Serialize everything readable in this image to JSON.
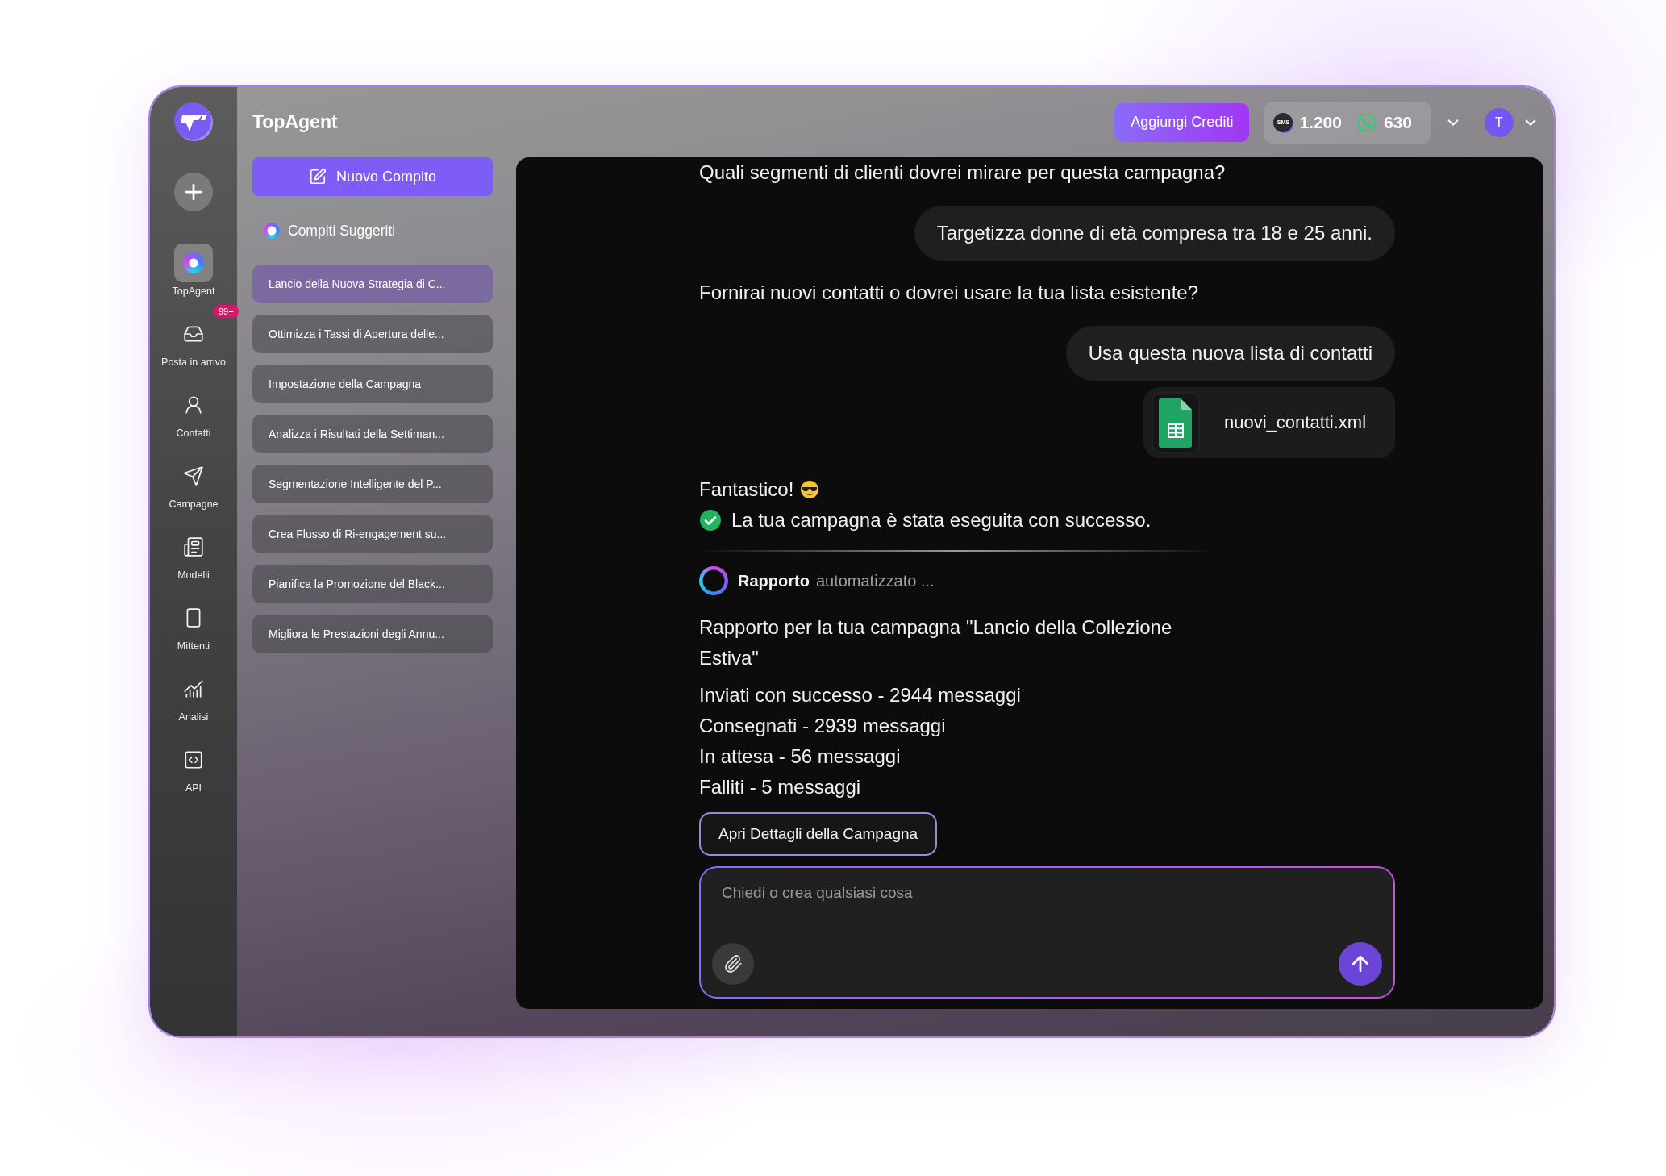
{
  "app": {
    "name": "TopAgent"
  },
  "rail": {
    "items": [
      {
        "label": "TopAgent",
        "selected": true
      },
      {
        "label": "Posta in arrivo",
        "selected": false,
        "badge": "99+"
      },
      {
        "label": "Contatti",
        "selected": false
      },
      {
        "label": "Campagne",
        "selected": false
      },
      {
        "label": "Modelli",
        "selected": false
      },
      {
        "label": "Mittenti",
        "selected": false
      },
      {
        "label": "Analisi",
        "selected": false
      },
      {
        "label": "API",
        "selected": false
      }
    ]
  },
  "topbar": {
    "add_credits": "Aggiungi Crediti",
    "sms_label": "SMS",
    "sms_credits": "1.200",
    "whatsapp_credits": "630",
    "avatar": "T"
  },
  "tasks": {
    "new_task": "Nuovo Compito",
    "heading": "Compiti Suggeriti",
    "items": [
      {
        "label": "Lancio della Nuova Strategia di C...",
        "selected": true
      },
      {
        "label": "Ottimizza i Tassi di Apertura delle...",
        "selected": false
      },
      {
        "label": "Impostazione della Campagna",
        "selected": false
      },
      {
        "label": "Analizza i Risultati della Settiman...",
        "selected": false
      },
      {
        "label": "Segmentazione Intelligente del P...",
        "selected": false
      },
      {
        "label": "Crea Flusso di Ri-engagement su...",
        "selected": false
      },
      {
        "label": "Pianifica la Promozione del Black...",
        "selected": false
      },
      {
        "label": "Migliora le Prestazioni degli Annu...",
        "selected": false
      }
    ]
  },
  "chat": {
    "messages": [
      {
        "kind": "agent",
        "text": "Quali segmenti di clienti dovrei mirare per questa campagna?"
      },
      {
        "kind": "user",
        "text": "Targetizza donne di età compresa tra 18 e 25 anni."
      },
      {
        "kind": "agent",
        "text": "Fornirai nuovi contatti o dovrei usare la tua lista esistente?"
      },
      {
        "kind": "user",
        "text": "Usa questa nuova lista di contatti"
      },
      {
        "kind": "file",
        "text": "nuovi_contatti.xml"
      },
      {
        "kind": "cheer",
        "text": "Fantastico!"
      },
      {
        "kind": "success",
        "text": "La tua campagna è stata eseguita con successo."
      },
      {
        "kind": "divider"
      },
      {
        "kind": "status",
        "text": "Rapporto",
        "detail": "automatizzato ..."
      },
      {
        "kind": "agent",
        "text": "Rapporto per la tua campagna \"Lancio della Collezione Estiva\""
      },
      {
        "kind": "stats",
        "lines": [
          "Inviati con successo - 2944 messaggi",
          "Consegnati - 2939 messaggi",
          "In attesa - 56 messaggi",
          "Falliti - 5 messaggi"
        ]
      },
      {
        "kind": "action",
        "text": "Apri Dettagli della Campagna"
      }
    ],
    "composer": {
      "placeholder": "Chiedi o crea qualsiasi cosa"
    }
  }
}
